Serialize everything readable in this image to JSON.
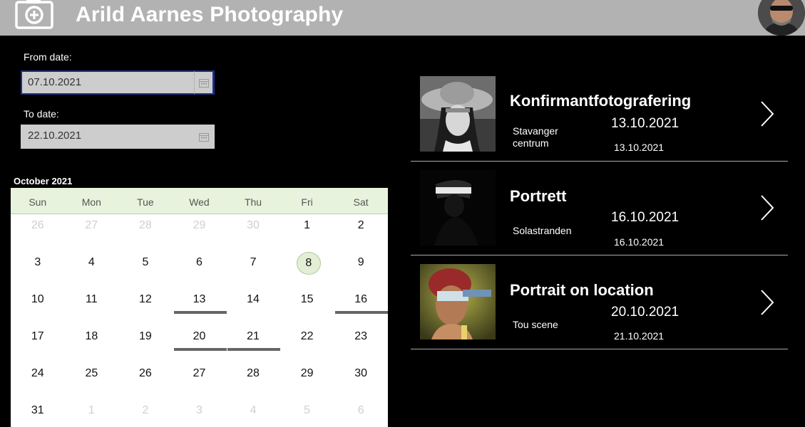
{
  "header": {
    "title": "Arild Aarnes Photography",
    "camera_icon": "camera-icon",
    "avatar_icon": "user-avatar"
  },
  "filters": {
    "from_label": "From date:",
    "from_value": "07.10.2021",
    "to_label": "To date:",
    "to_value": "22.10.2021",
    "picker_icon": "calendar-icon"
  },
  "calendar": {
    "month": "October 2021",
    "weekdays": [
      "Sun",
      "Mon",
      "Tue",
      "Wed",
      "Thu",
      "Fri",
      "Sat"
    ],
    "weeks": [
      [
        "26",
        "27",
        "28",
        "29",
        "30",
        "1",
        "2"
      ],
      [
        "3",
        "4",
        "5",
        "6",
        "7",
        "8",
        "9"
      ],
      [
        "10",
        "11",
        "12",
        "13",
        "14",
        "15",
        "16"
      ],
      [
        "17",
        "18",
        "19",
        "20",
        "21",
        "22",
        "23"
      ],
      [
        "24",
        "25",
        "26",
        "27",
        "28",
        "29",
        "30"
      ],
      [
        "31",
        "1",
        "2",
        "3",
        "4",
        "5",
        "6"
      ]
    ]
  },
  "events": [
    {
      "title": "Konfirmantfotografering",
      "location": "Stavanger centrum",
      "start": "13.10.2021",
      "end": "13.10.2021"
    },
    {
      "title": "Portrett",
      "location": "Solastranden",
      "start": "16.10.2021",
      "end": "16.10.2021"
    },
    {
      "title": "Portrait on location",
      "location": "Tou scene",
      "start": "20.10.2021",
      "end": "21.10.2021"
    }
  ],
  "icons": {
    "chevron": "chevron-right-icon"
  },
  "colors": {
    "header_bg": "#b2b2b2",
    "calendar_header_bg": "#e8f3de",
    "today_fill": "#e2efd5",
    "focus_border": "#1b2f8c"
  }
}
